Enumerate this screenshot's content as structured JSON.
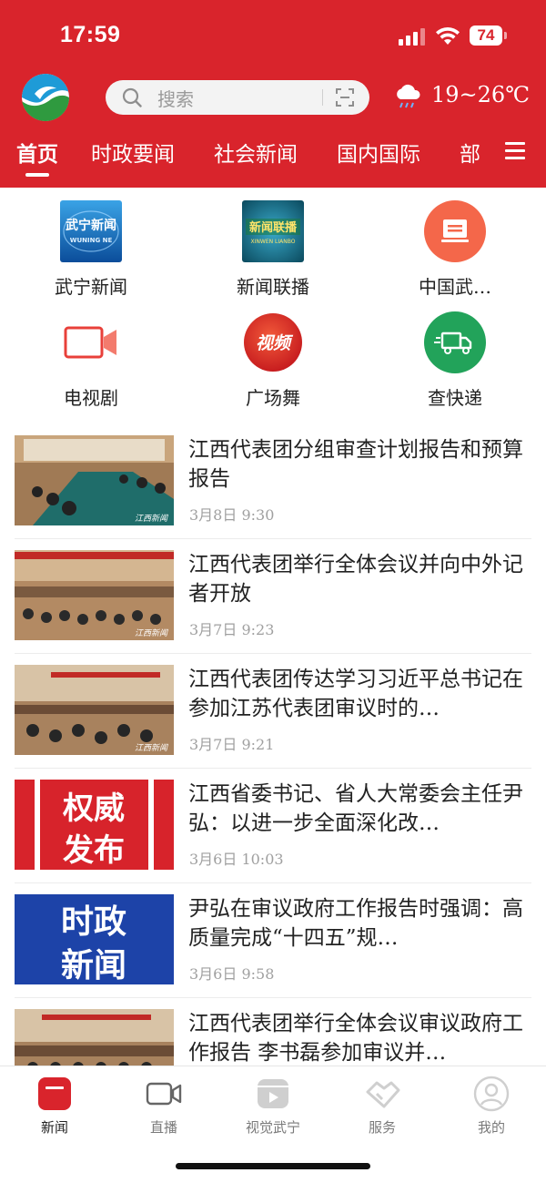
{
  "status_bar": {
    "time": "17:59",
    "battery": "74"
  },
  "header": {
    "logo_icon": "wuning-logo",
    "search": {
      "placeholder": "搜索",
      "icon": "search-icon",
      "scan_icon": "scan-icon"
    },
    "weather": {
      "icon": "rain-cloud-icon",
      "temp_range": "19~26℃"
    },
    "tabs": [
      {
        "label": "首页",
        "active": true
      },
      {
        "label": "时政要闻"
      },
      {
        "label": "社会新闻"
      },
      {
        "label": "国内国际"
      },
      {
        "label": "部"
      }
    ],
    "menu_icon": "hamburger-menu-icon"
  },
  "shortcuts": [
    {
      "label": "武宁新闻",
      "icon": "wuning-news-icon",
      "icon_text": "武宁新闻",
      "icon_subtext": "WUNING NE"
    },
    {
      "label": "新闻联播",
      "icon": "xinwen-lianbo-icon",
      "icon_text": "新闻联播",
      "icon_subtext": "XINWEN LIANBO"
    },
    {
      "label": "中国武…",
      "icon": "orange-document-icon"
    },
    {
      "label": "电视剧",
      "icon": "video-camera-icon"
    },
    {
      "label": "广场舞",
      "icon": "video-badge-icon",
      "icon_text": "视频"
    },
    {
      "label": "查快递",
      "icon": "delivery-truck-icon"
    }
  ],
  "news": [
    {
      "title": "江西代表团分组审查计划报告和预算报告",
      "date": "3月8日  9:30",
      "thumb": "meeting-photo",
      "thumb_watermark": "江西新闻"
    },
    {
      "title": "江西代表团举行全体会议并向中外记者开放",
      "date": "3月7日  9:23",
      "thumb": "meeting-photo",
      "thumb_watermark": "江西新闻"
    },
    {
      "title": "江西代表团传达学习习近平总书记在参加江苏代表团审议时的…",
      "date": "3月7日  9:21",
      "thumb": "meeting-photo",
      "thumb_watermark": "江西新闻"
    },
    {
      "title": "江西省委书记、省人大常委会主任尹弘：以进一步全面深化改…",
      "date": "3月6日  10:03",
      "thumb": "text-banner",
      "thumb_line1": "权威",
      "thumb_line2": "发布",
      "thumb_color": "#d7232b"
    },
    {
      "title": "尹弘在审议政府工作报告时强调：高质量完成“十四五”规…",
      "date": "3月6日  9:58",
      "thumb": "text-banner",
      "thumb_line1": "时政",
      "thumb_line2": "新闻",
      "thumb_color": "#1d43a8"
    },
    {
      "title": "江西代表团举行全体会议审议政府工作报告 李书磊参加审议并…",
      "date": "",
      "thumb": "meeting-photo"
    }
  ],
  "bottom_nav": [
    {
      "label": "新闻",
      "icon": "news-icon",
      "active": true
    },
    {
      "label": "直播",
      "icon": "video-camera-icon"
    },
    {
      "label": "视觉武宁",
      "icon": "play-box-icon"
    },
    {
      "label": "服务",
      "icon": "handshake-icon"
    },
    {
      "label": "我的",
      "icon": "user-icon"
    }
  ],
  "colors": {
    "brand_red": "#d9242c",
    "text": "#222222",
    "muted": "#a0a0a0"
  }
}
